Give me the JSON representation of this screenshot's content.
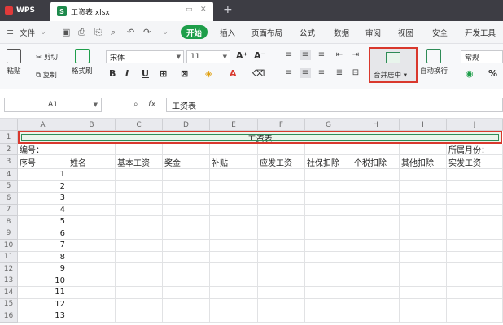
{
  "titlebar": {
    "app": "WPS",
    "doc_tab": "工资表.xlsx"
  },
  "menu": {
    "file": "文件",
    "start": "开始",
    "items": [
      "插入",
      "页面布局",
      "公式",
      "数据",
      "审阅",
      "视图",
      "安全",
      "开发工具"
    ]
  },
  "ribbon": {
    "paste": "粘贴",
    "cut": "剪切",
    "copy": "复制",
    "format_painter": "格式刷",
    "font_name": "宋体",
    "font_size": "11",
    "merge_center": "合并居中",
    "wrap": "自动换行",
    "number_format": "常规"
  },
  "formula": {
    "name_box": "A1",
    "fx": "fx",
    "value": "工资表"
  },
  "columns": [
    "A",
    "B",
    "C",
    "D",
    "E",
    "F",
    "G",
    "H",
    "I",
    "J"
  ],
  "rows": [
    "1",
    "2",
    "3",
    "4",
    "5",
    "6",
    "7",
    "8",
    "9",
    "10",
    "11",
    "12",
    "13",
    "14",
    "15",
    "16"
  ],
  "sheet": {
    "title": "工资表",
    "row2_a": "编号：",
    "row2_j": "所属月份：",
    "headers": [
      "序号",
      "姓名",
      "基本工资",
      "奖金",
      "补贴",
      "应发工资",
      "社保扣除",
      "个税扣除",
      "其他扣除",
      "实发工资"
    ],
    "serials": [
      "1",
      "2",
      "3",
      "4",
      "5",
      "6",
      "7",
      "8",
      "9",
      "10",
      "11",
      "12",
      "13"
    ]
  }
}
